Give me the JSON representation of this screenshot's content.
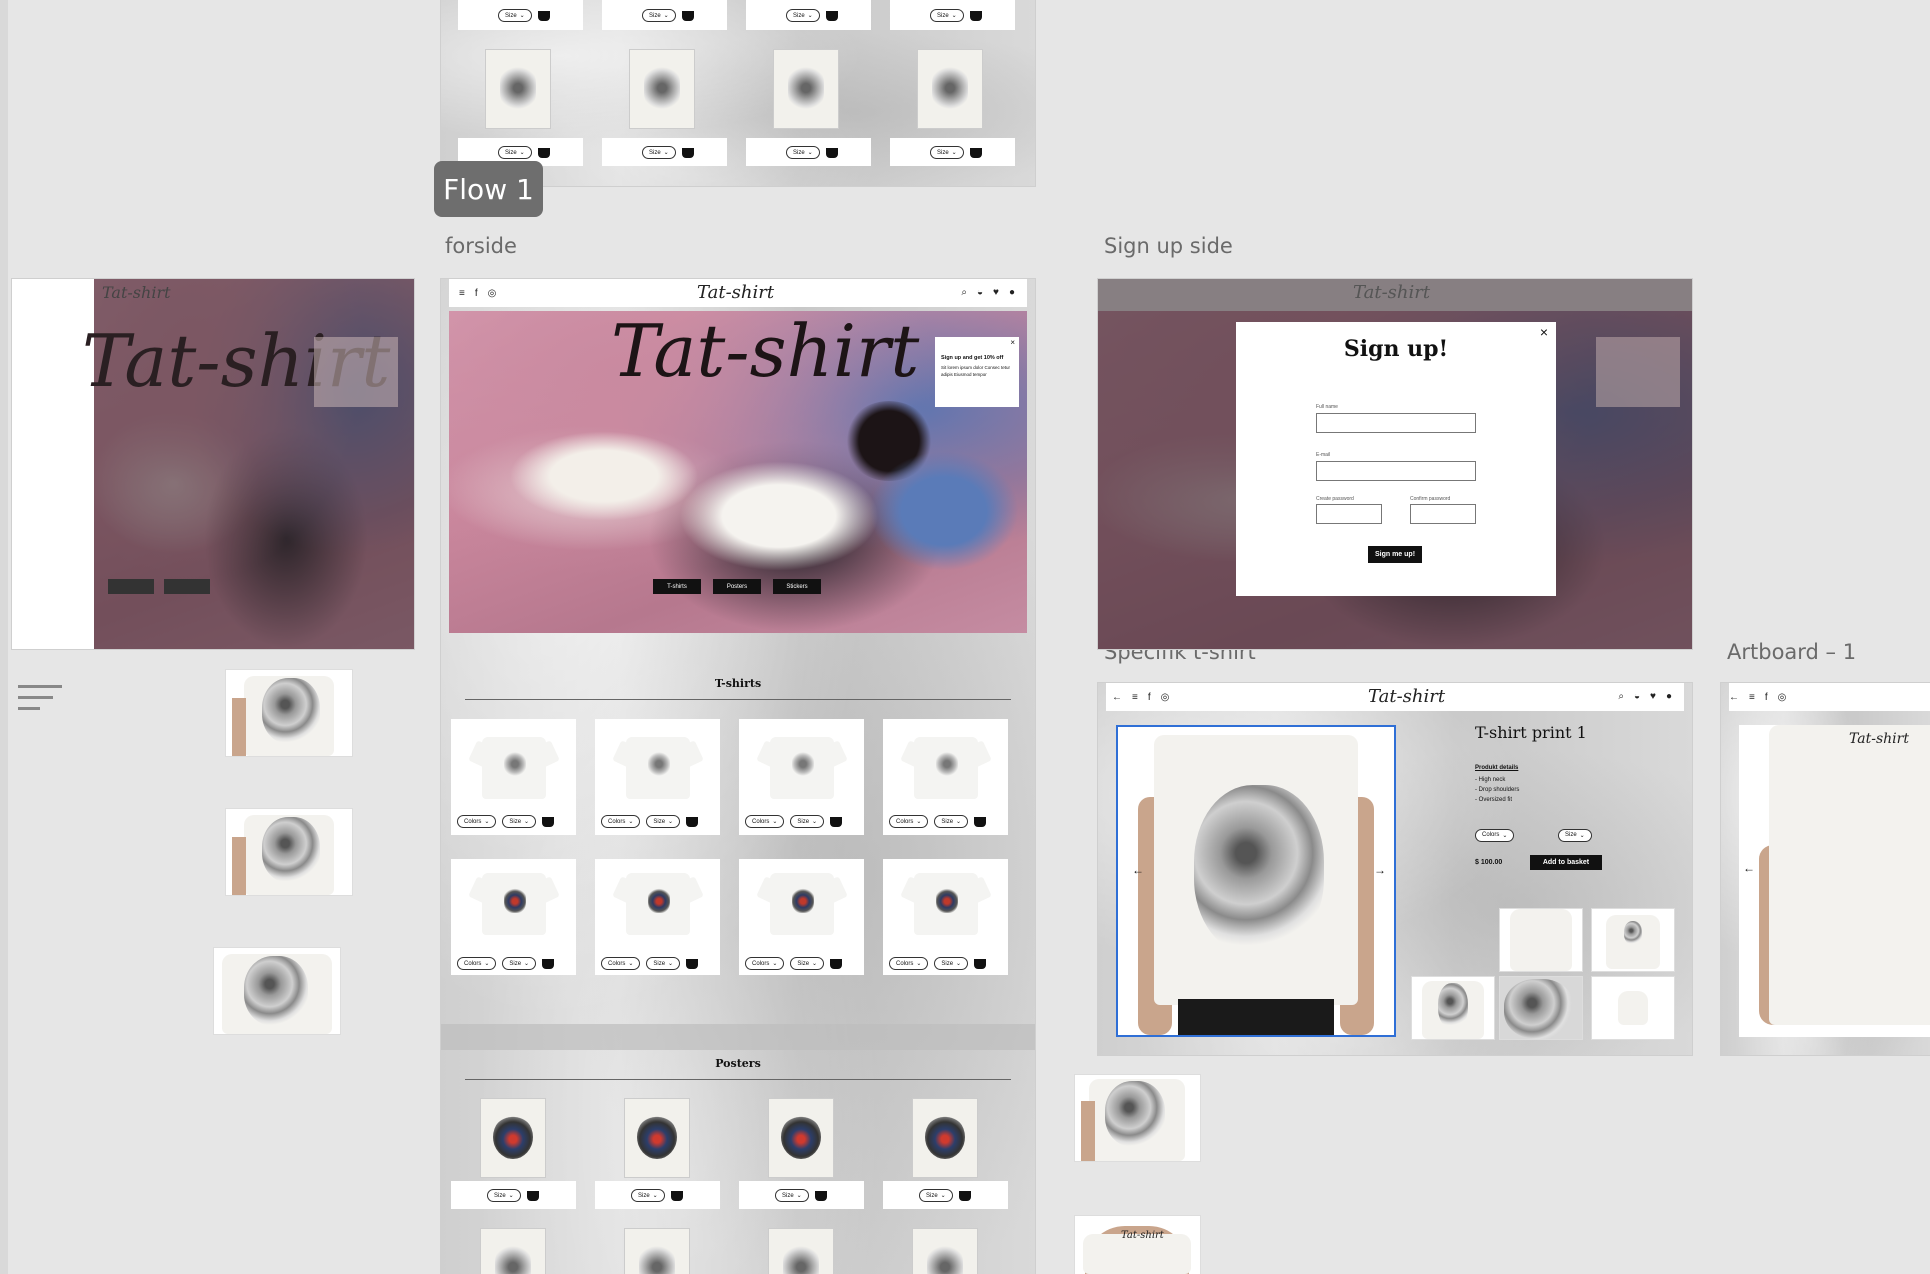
{
  "labels": {
    "flow": "Flow 1",
    "forside": "forside",
    "signup": "Sign up side",
    "specifik": "Specifik t-shirt",
    "artboard1": "Artboard – 1"
  },
  "brand": {
    "logo": "Tat-shirt",
    "hero_title": "Tat-shirt"
  },
  "popup": {
    "title": "Sign up and get 10% off",
    "body": "Sit lorem ipsum dolor Consec tetur adipis Eiusmod tempor"
  },
  "hero_buttons": [
    "T-shirts",
    "Posters",
    "Stickers"
  ],
  "sections": {
    "tshirts": "T-shirts",
    "posters": "Posters"
  },
  "controls": {
    "colors": "Colors",
    "size": "Size"
  },
  "signup_modal": {
    "title": "Sign up!",
    "full_name": "Full name",
    "email": "E-mail",
    "create_password": "Create password",
    "confirm_password": "Confirm password",
    "submit": "Sign me up!",
    "close": "×"
  },
  "product": {
    "title": "T-shirt print 1",
    "details_heading": "Produkt details",
    "details": [
      "- High neck",
      "- Drop shoulders",
      "- Oversized fit"
    ],
    "price": "$ 100.00",
    "add_to_basket": "Add to basket"
  },
  "colors": {
    "accent_select": "#2f6fd6",
    "dark": "#111111",
    "canvas": "#e6e6e6"
  }
}
